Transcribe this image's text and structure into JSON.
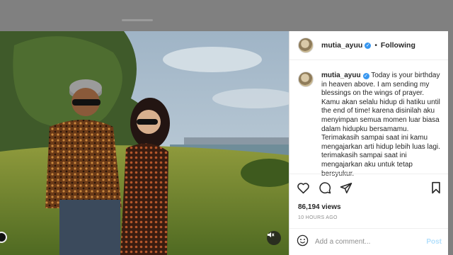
{
  "post": {
    "username": "mutia_ayuu",
    "follow_status": "Following",
    "separator": "•",
    "verified_glyph": "✓",
    "caption_username": "mutia_ayuu",
    "caption_text": "Today is your birthday in heaven above. I am sending my blessings on the wings of prayer. Kamu akan selalu hidup di hatiku until the end of time! karena disinilah aku menyimpan semua momen luar biasa dalam hidupku bersamamu. Terimakasih sampai saat ini kamu mengajarkan arti hidup lebih luas lagi. terimakasih sampai saat ini mengajarkan aku untuk tetap bersyukur.",
    "views": "86,194 views",
    "timestamp": "10 HOURS AGO"
  },
  "comment": {
    "placeholder": "Add a comment...",
    "post_label": "Post"
  },
  "icons": {
    "like": "heart-icon",
    "comment": "comment-icon",
    "share": "paper-plane-icon",
    "save": "bookmark-icon",
    "emoji": "emoji-icon",
    "mute": "speaker-muted-icon",
    "verified": "verified-badge-icon"
  },
  "colors": {
    "link_blue": "#3897f0",
    "post_button_disabled": "#b2dffc",
    "text": "#262626",
    "muted": "#8e8e8e"
  }
}
